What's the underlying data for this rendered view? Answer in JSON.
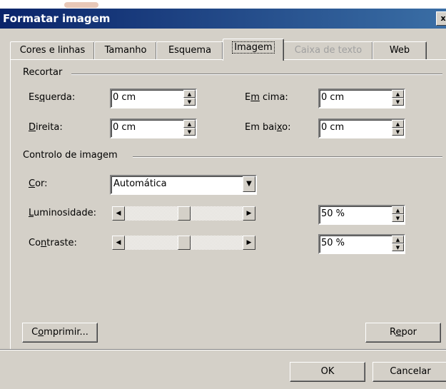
{
  "window": {
    "title": "Formatar imagem",
    "close": "x"
  },
  "tabs": [
    {
      "label": "Cores e linhas"
    },
    {
      "label": "Tamanho"
    },
    {
      "label": "Esquema"
    },
    {
      "label": "Imagem",
      "active": true
    },
    {
      "label": "Caixa de texto",
      "disabled": true
    },
    {
      "label": "Web"
    }
  ],
  "crop": {
    "group_label": "Recortar",
    "left": {
      "label_pre": "Es",
      "label_u": "q",
      "label_post": "uerda:",
      "value": "0 cm"
    },
    "right": {
      "label_pre": "",
      "label_u": "D",
      "label_post": "ireita:",
      "value": "0 cm"
    },
    "top": {
      "label_pre": "E",
      "label_u": "m",
      "label_post": " cima:",
      "value": "0 cm"
    },
    "bottom": {
      "label_pre": "Em bai",
      "label_u": "x",
      "label_post": "o:",
      "value": "0 cm"
    }
  },
  "image_control": {
    "group_label": "Controlo de imagem",
    "color": {
      "label_pre": "",
      "label_u": "C",
      "label_post": "or:",
      "value": "Automática"
    },
    "brightness": {
      "label_pre": "",
      "label_u": "L",
      "label_post": "uminosidade:",
      "value": "50 %",
      "level": 0.5
    },
    "contrast": {
      "label_pre": "Co",
      "label_u": "n",
      "label_post": "traste:",
      "value": "50 %",
      "level": 0.5
    }
  },
  "buttons": {
    "compress": {
      "pre": "C",
      "u": "o",
      "post": "mprimir..."
    },
    "reset": {
      "pre": "R",
      "u": "e",
      "post": "por"
    },
    "ok": "OK",
    "cancel": "Cancelar"
  },
  "icons": {
    "up": "▲",
    "down": "▼",
    "left": "◀",
    "right": "▶"
  }
}
